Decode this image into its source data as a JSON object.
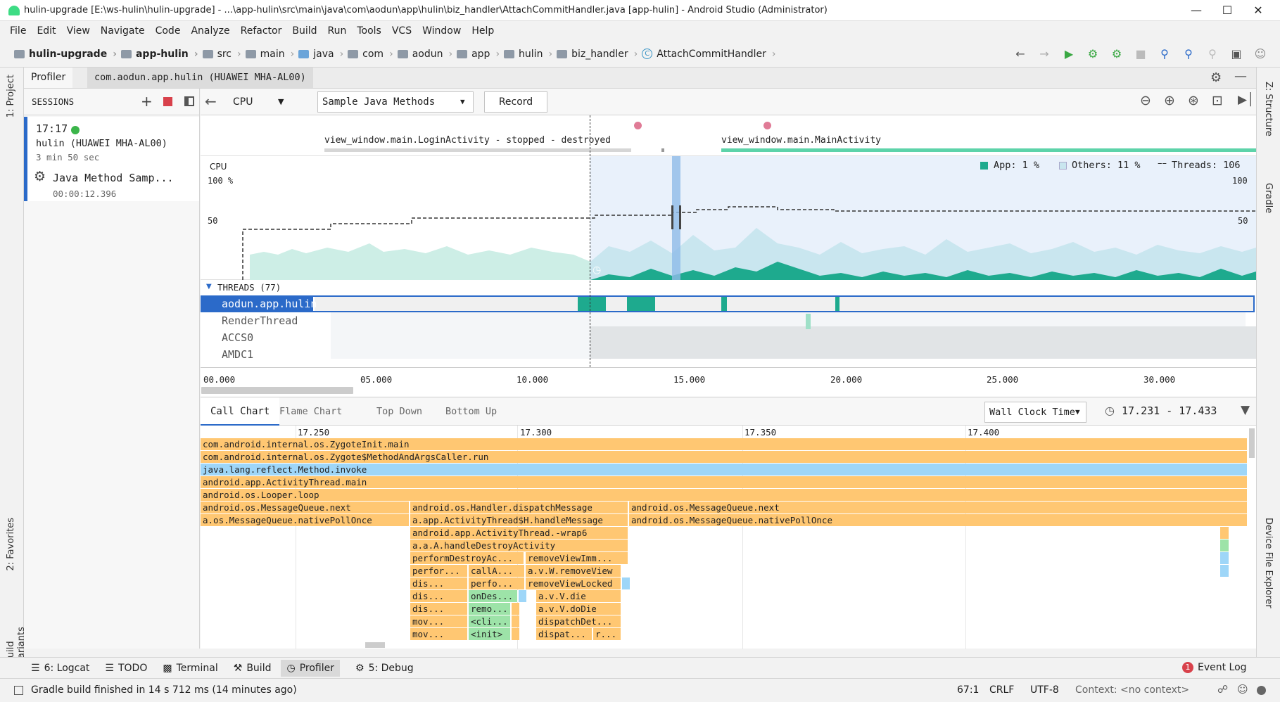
{
  "window": {
    "title": "hulin-upgrade [E:\\ws-hulin\\hulin-upgrade] - ...\\app-hulin\\src\\main\\java\\com\\aodun\\app\\hulin\\biz_handler\\AttachCommitHandler.java [app-hulin] - Android Studio (Administrator)"
  },
  "menu": [
    "File",
    "Edit",
    "View",
    "Navigate",
    "Code",
    "Analyze",
    "Refactor",
    "Build",
    "Run",
    "Tools",
    "VCS",
    "Window",
    "Help"
  ],
  "breadcrumbs": [
    "hulin-upgrade",
    "app-hulin",
    "src",
    "main",
    "java",
    "com",
    "aodun",
    "app",
    "hulin",
    "biz_handler",
    "AttachCommitHandler"
  ],
  "left_tools": {
    "project": "1: Project",
    "favorites": "2: Favorites",
    "build_variants": "Build Variants"
  },
  "right_tools": {
    "structure": "Z: Structure",
    "gradle": "Gradle",
    "device_file_explorer": "Device File Explorer"
  },
  "profiler_tabs": [
    "Profiler",
    "com.aodun.app.hulin (HUAWEI MHA-AL00)"
  ],
  "sessions": {
    "header": "SESSIONS",
    "time": "17:17",
    "device": "hulin (HUAWEI MHA-AL00)",
    "duration": "3 min 50 sec",
    "capture_label": "Java Method Samp...",
    "capture_time": "00:00:12.396"
  },
  "toolbar": {
    "monitor": "CPU",
    "config": "Sample Java Methods",
    "record": "Record"
  },
  "activities": {
    "login": "view_window.main.LoginActivity - stopped - destroyed",
    "main": "view_window.main.MainActivity"
  },
  "cpu": {
    "label": "CPU",
    "y_100": "100 %",
    "y_50": "50",
    "y_100_right": "100",
    "y_50_right": "50",
    "legend_app": "App: 1 %",
    "legend_others": "Others: 11 %",
    "legend_threads": "Threads: 106"
  },
  "threads": {
    "header": "THREADS (77)",
    "rows": [
      "aodun.app.hulin",
      "RenderThread",
      "ACCS0",
      "AMDC1"
    ]
  },
  "time_axis": [
    "00.000",
    "05.000",
    "10.000",
    "15.000",
    "20.000",
    "25.000",
    "30.000"
  ],
  "chart_tabs": [
    "Call Chart",
    "Flame Chart",
    "Top Down",
    "Bottom Up"
  ],
  "clock": {
    "mode": "Wall Clock Time",
    "range": "17.231 - 17.433"
  },
  "call_axis": [
    "17.250",
    "17.300",
    "17.350",
    "17.400"
  ],
  "call_chart": {
    "full": [
      "com.android.internal.os.ZygoteInit.main",
      "com.android.internal.os.Zygote$MethodAndArgsCaller.run",
      "java.lang.reflect.Method.invoke",
      "android.app.ActivityThread.main",
      "android.os.Looper.loop"
    ],
    "col1": [
      "android.os.MessageQueue.next",
      "a.os.MessageQueue.nativePollOnce"
    ],
    "col2": [
      "android.os.Handler.dispatchMessage",
      "a.app.ActivityThread$H.handleMessage",
      "android.app.ActivityThread.-wrap6",
      "a.a.A.handleDestroyActivity"
    ],
    "col3": [
      "android.os.MessageQueue.next",
      "android.os.MessageQueue.nativePollOnce"
    ],
    "sub_a": [
      "performDestroyAc...",
      "perfor...",
      "dis...",
      "dis...",
      "dis...",
      "mov...",
      "mov..."
    ],
    "sub_b": [
      "callA...",
      "perfo...",
      "onDes...",
      "remo...",
      "<cli...",
      "<init>"
    ],
    "sub_c": [
      "removeViewImm...",
      "a.v.W.removeView",
      "removeViewLocked",
      "a.v.V.die",
      "a.v.V.doDie",
      "dispatchDet...",
      "dispat..."
    ],
    "sub_d": "r..."
  },
  "bottom_tools": [
    "6: Logcat",
    "TODO",
    "Terminal",
    "Build",
    "Profiler",
    "5: Debug"
  ],
  "event_log": {
    "count": "1",
    "label": "Event Log"
  },
  "status": {
    "message": "Gradle build finished in 14 s 712 ms (14 minutes ago)",
    "position": "67:1",
    "line_sep": "CRLF",
    "encoding": "UTF-8",
    "context": "Context: <no context>"
  },
  "colors": {
    "accent": "#2b6ac9",
    "app_cpu": "#1eaa8e",
    "others_cpu": "#c9e6ef",
    "activity_bar": "#5dd3a9",
    "call_orange": "#ffc772",
    "call_blue": "#9ed6f8",
    "call_green": "#9de3a8"
  }
}
